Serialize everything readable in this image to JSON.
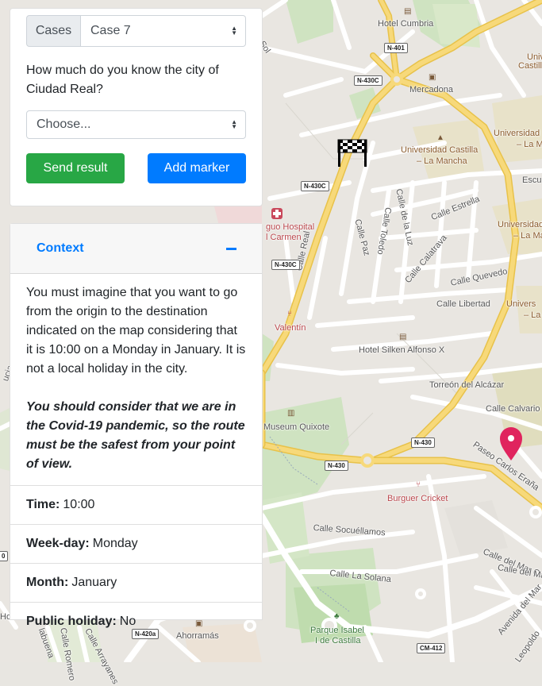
{
  "controls": {
    "cases_label": "Cases",
    "case_selected": "Case 7",
    "question": "How much do you know the city of Ciudad Real?",
    "knowledge_selected": "Choose...",
    "send_button": "Send result",
    "add_marker_button": "Add marker"
  },
  "context": {
    "header": "Context",
    "description": "You must imagine that you want to go from the origin to the destination indicated on the map considering that it is 10:00 on a Monday in January. It is not a local holiday in the city.",
    "emphasis": "You should consider that we are in the Covid-19 pandemic, so the route must be the safest from your point of view.",
    "details": [
      {
        "label": "Time:",
        "value": "10:00"
      },
      {
        "label": "Week-day:",
        "value": "Monday"
      },
      {
        "label": "Month:",
        "value": "January"
      },
      {
        "label": "Public holiday:",
        "value": "No"
      }
    ]
  },
  "map": {
    "labels": {
      "hotel_cumbria": "Hotel Cumbria",
      "mercadona": "Mercadona",
      "universidad_1": "Universidad Castilla",
      "universidad_2": "– La Mancha",
      "uni_r1a": "Universidad",
      "uni_r1b": "– La Ma",
      "uni_r2a": "Universidad",
      "uni_r2b": "– La Ma",
      "uni_r3a": "Univers",
      "uni_r3b": "– La",
      "uni_top_a": "Univ",
      "uni_top_b": "Castill",
      "escu": "Escu",
      "hospital_1": "guo Hospital",
      "hospital_2": "l Carmen",
      "valentin": "Valentín",
      "hotel_silken": "Hotel Silken Alfonso X",
      "torreon": "Torreón del Alcázar",
      "museum": "Museum Quixote",
      "burguer": "Burguer Cricket",
      "parque_1": "Parque Isabel",
      "parque_2": "I de Castilla",
      "ahorramas": "Ahorramás",
      "calle_real": "Calle Real",
      "calle_paz": "Calle Paz",
      "calle_toledo": "Calle Toledo",
      "calle_luz": "Calle de la Luz",
      "calle_estrella": "Calle Estrella",
      "calle_calatrava": "Calle Calatrava",
      "calle_quevedo": "Calle Quevedo",
      "calle_libertad": "Calle Libertad",
      "calle_calvario": "Calle Calvario",
      "paseo_carlos": "Paseo Carlos Eraña",
      "calle_socuellamos": "Calle Socuéllamos",
      "calle_solana": "Calle La Solana",
      "calle_mar_c_1": "Calle del Mar C",
      "calle_mar_c_2": "Calle del Mar C",
      "avenida_mar": "Avenida del Mar",
      "leopoldo": "Leopoldo",
      "arrayanes": "Calle Arrayanes",
      "romero": "Calle Romero",
      "labuena": "labuena",
      "sol": "Sol",
      "ho": "Ho",
      "ucia": "ucia"
    },
    "shields": {
      "n401": "N-401",
      "n430c_a": "N-430C",
      "n430c_b": "N-430C",
      "n430c_c": "N-430C",
      "n430_a": "N-430",
      "n430_b": "N-430",
      "n420a": "N-420a",
      "cm412": "CM-412",
      "left_0": "0"
    }
  }
}
